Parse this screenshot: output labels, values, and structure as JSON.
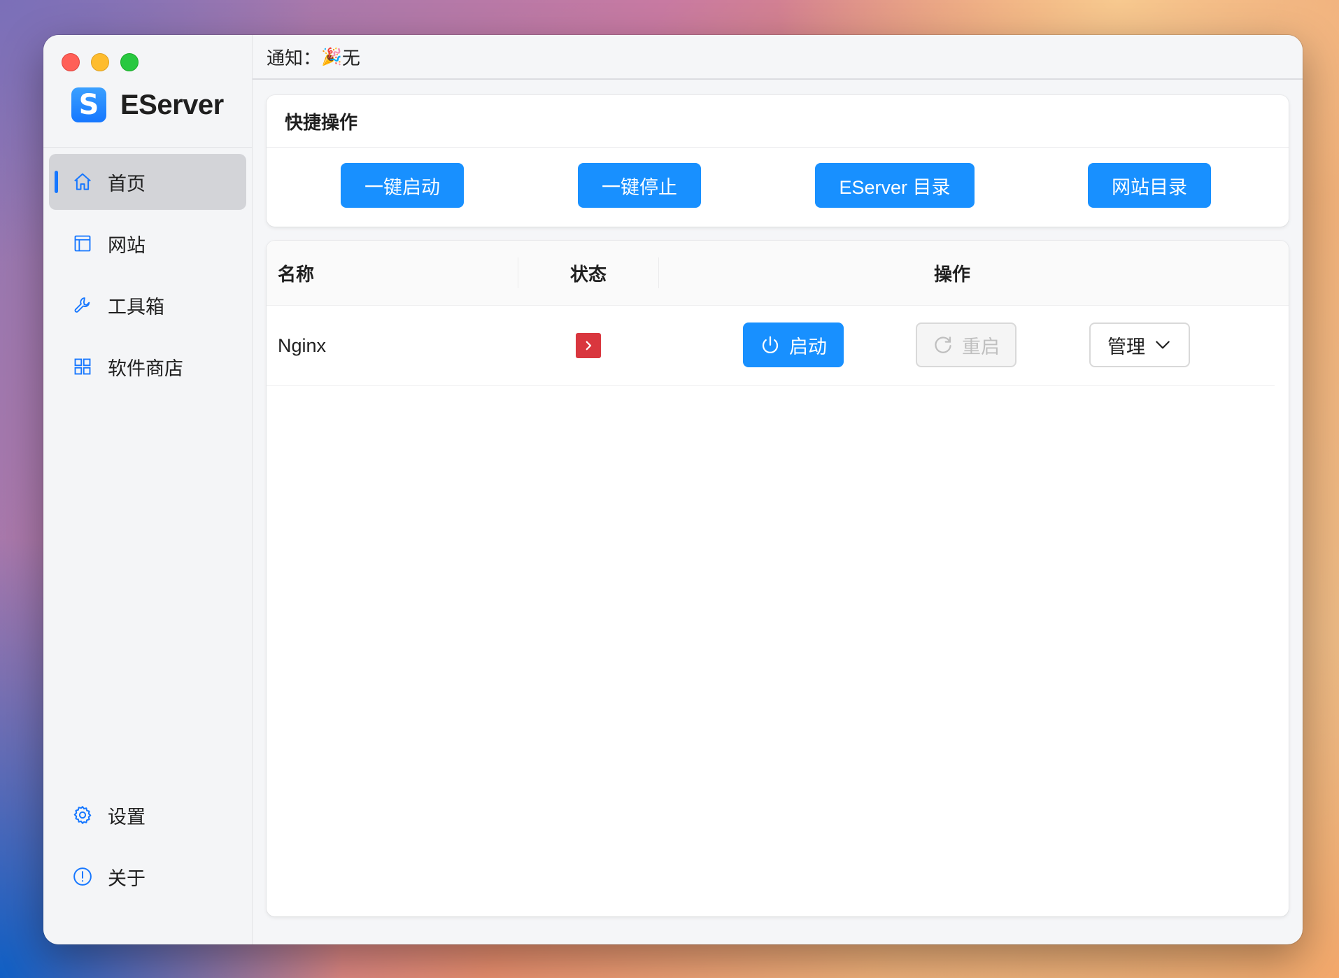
{
  "app": {
    "name": "EServer",
    "logo_letter": "S"
  },
  "sidebar": {
    "items": [
      {
        "label": "首页",
        "icon": "home-icon",
        "active": true
      },
      {
        "label": "网站",
        "icon": "layout-icon",
        "active": false
      },
      {
        "label": "工具箱",
        "icon": "wrench-icon",
        "active": false
      },
      {
        "label": "软件商店",
        "icon": "grid-icon",
        "active": false
      }
    ],
    "bottom_items": [
      {
        "label": "设置",
        "icon": "gear-icon"
      },
      {
        "label": "关于",
        "icon": "info-icon"
      }
    ]
  },
  "notification": {
    "label": "通知：",
    "emoji": "🎉",
    "text": "无"
  },
  "quick_actions": {
    "title": "快捷操作",
    "buttons": [
      "一键启动",
      "一键停止",
      "EServer 目录",
      "网站目录"
    ]
  },
  "table": {
    "columns": [
      "名称",
      "状态",
      "操作"
    ],
    "rows": [
      {
        "name": "Nginx",
        "status_icon": "stopped-icon",
        "start_label": "启动",
        "restart_label": "重启",
        "manage_label": "管理"
      }
    ]
  },
  "colors": {
    "primary": "#1890ff",
    "status_stopped": "#d9363e",
    "active_nav_bg": "#d3d4d8"
  }
}
